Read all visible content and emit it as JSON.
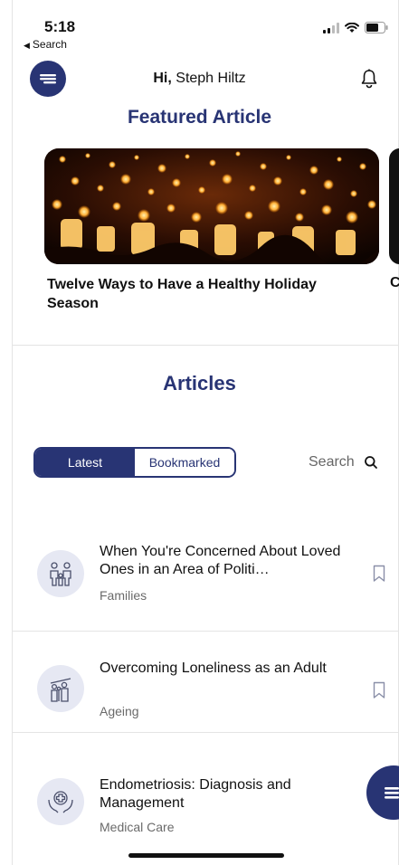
{
  "status_bar": {
    "time": "5:18",
    "back_label": "Search"
  },
  "header": {
    "greeting_prefix": "Hi,",
    "user_name": "Steph Hiltz"
  },
  "featured": {
    "title": "Featured Article",
    "card_title": "Twelve Ways to Have a Healthy Holiday Season",
    "next_card_initial": "C"
  },
  "articles": {
    "title": "Articles",
    "tabs": [
      {
        "label": "Latest",
        "selected": true
      },
      {
        "label": "Bookmarked",
        "selected": false
      }
    ],
    "search_label": "Search",
    "items": [
      {
        "title": "When You're Concerned About Loved Ones in an Area of Politi…",
        "category": "Families",
        "icon": "family-icon"
      },
      {
        "title": "Overcoming Loneliness as an Adult",
        "category": "Ageing",
        "icon": "ageing-icon"
      },
      {
        "title": "Endometriosis: Diagnosis and Management",
        "category": "Medical Care",
        "icon": "medical-care-icon"
      }
    ]
  },
  "colors": {
    "brand": "#283474",
    "icon_bg": "#e6e8f3",
    "divider": "#e4e4e4",
    "muted_text": "#6a6a6a"
  }
}
